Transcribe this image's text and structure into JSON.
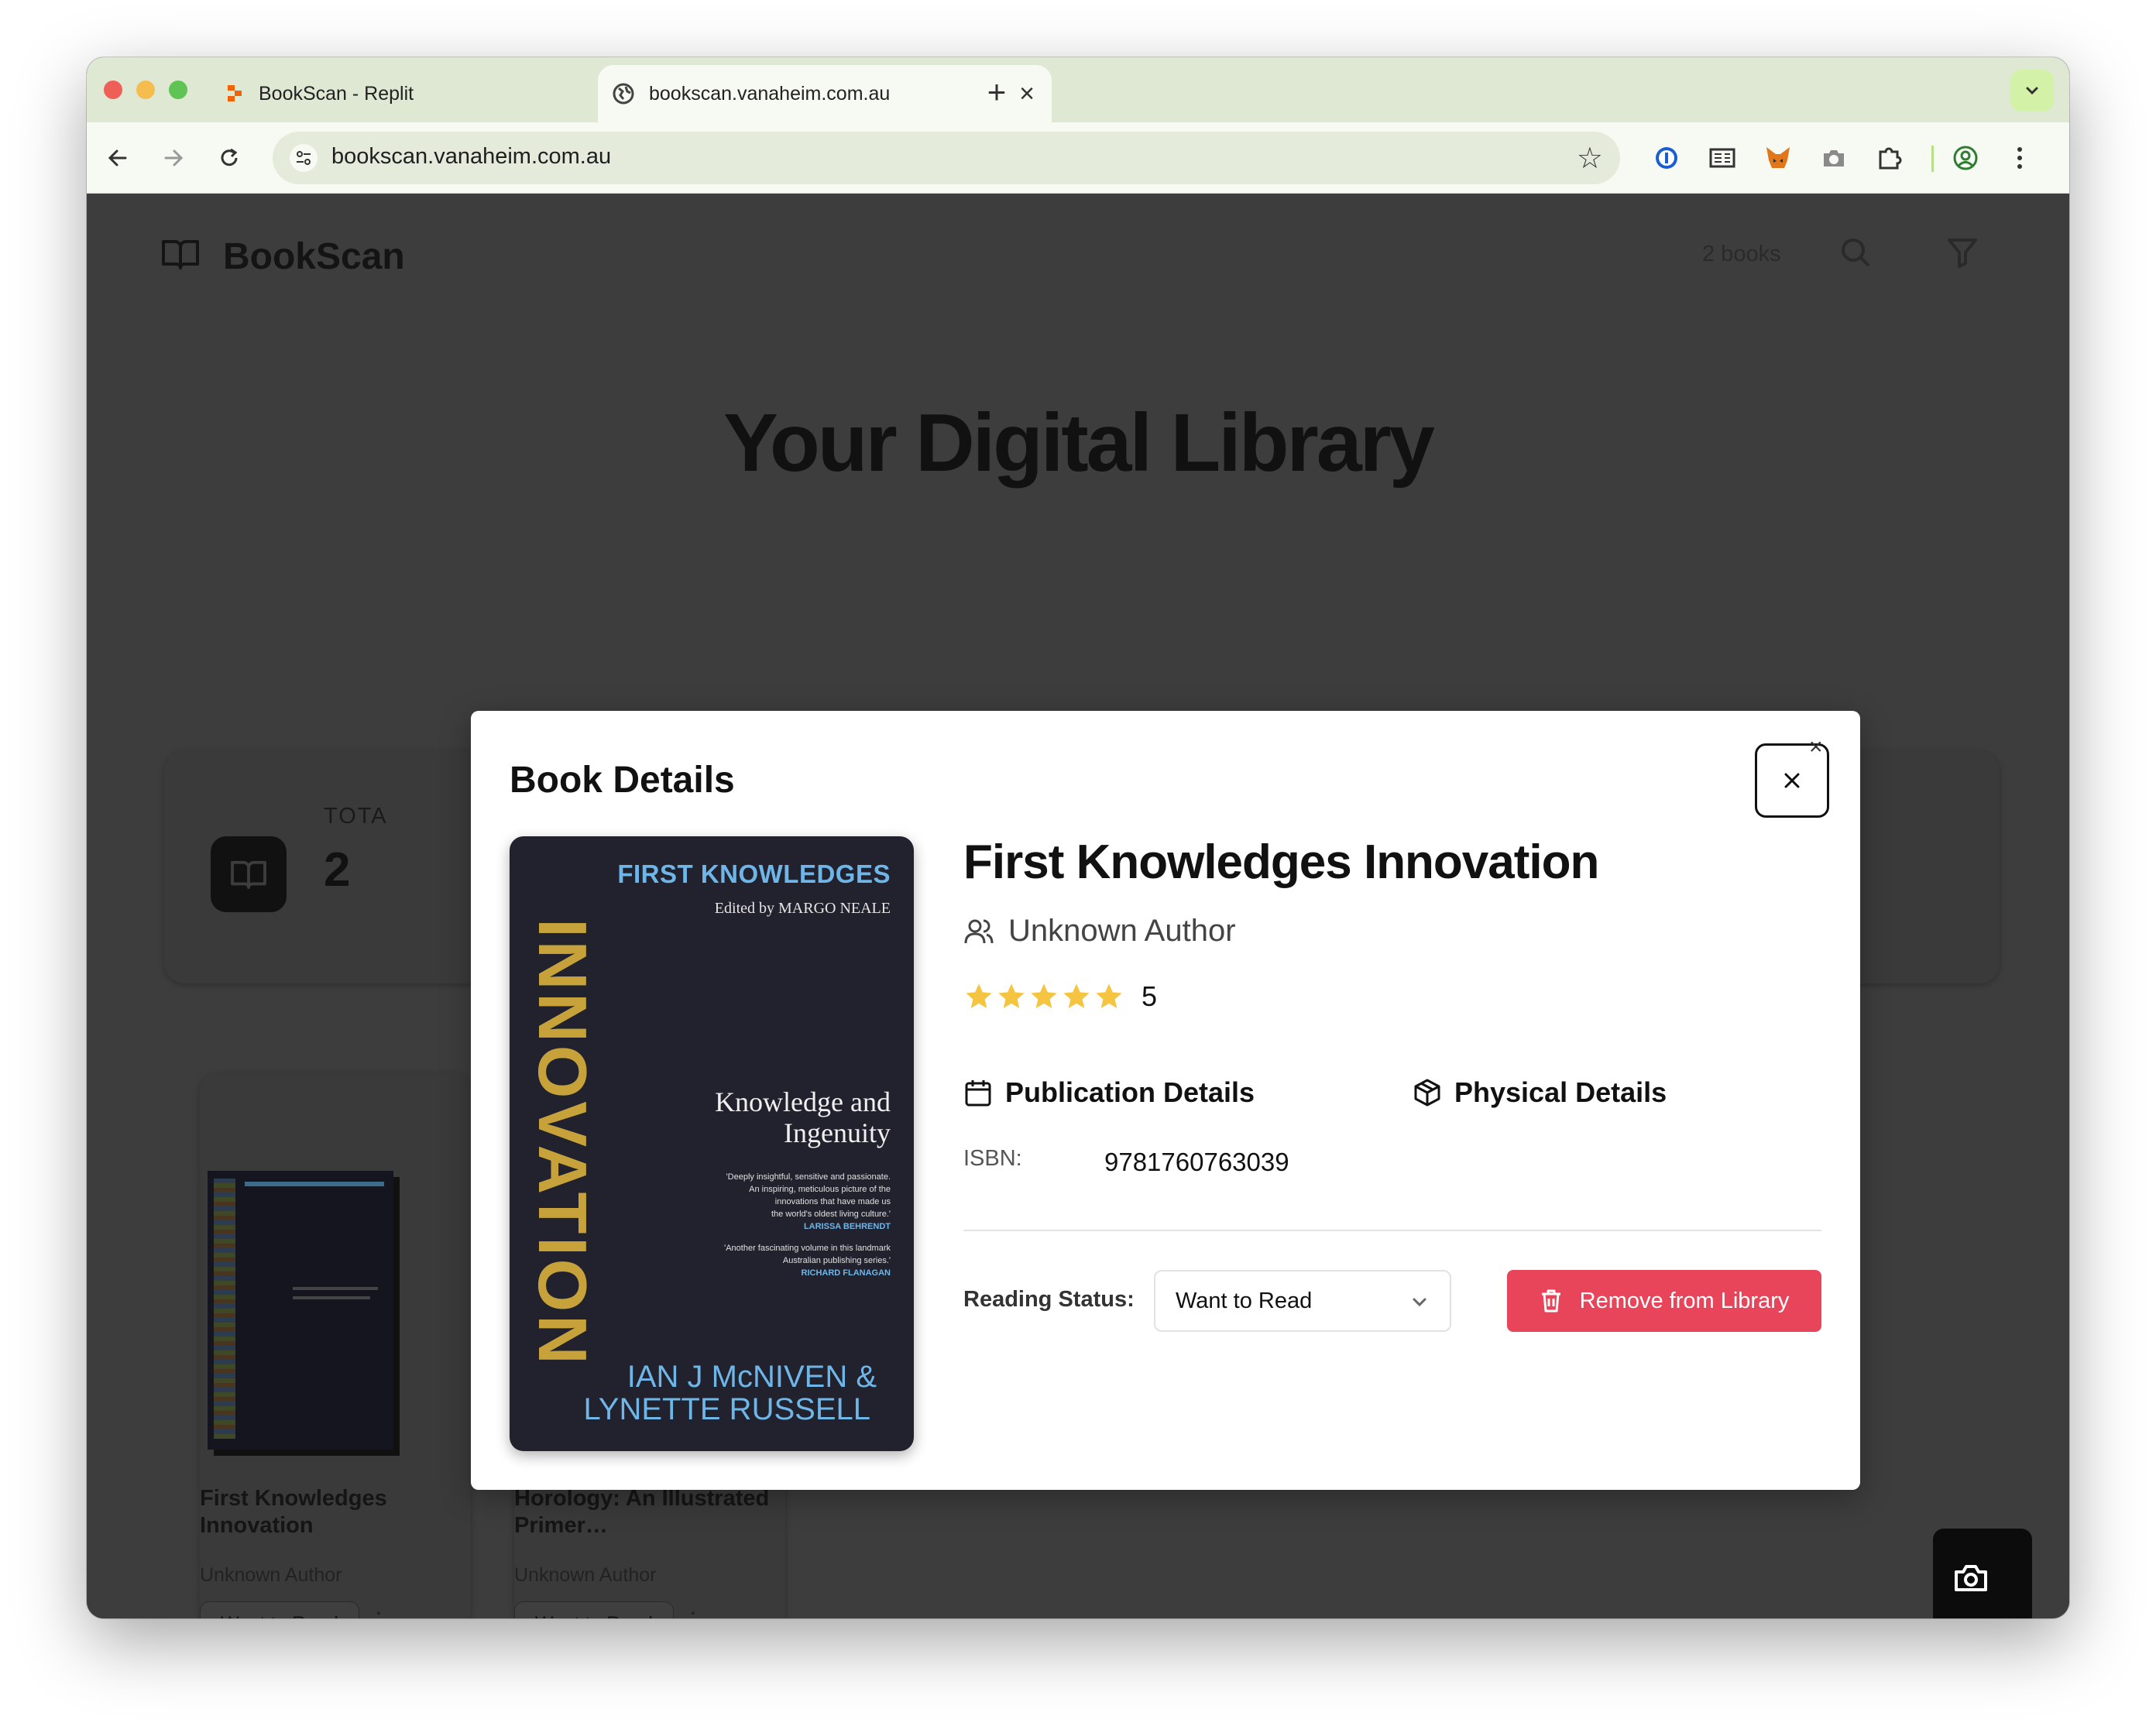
{
  "browser": {
    "tabs": [
      {
        "title": "BookScan - Replit",
        "active": false
      },
      {
        "title": "bookscan.vanaheim.com.au",
        "active": true
      }
    ],
    "new_tab_symbol": "+",
    "close_symbol": "×",
    "url": "bookscan.vanaheim.com.au",
    "extension_icons": [
      "password-manager-icon",
      "reader-icon",
      "fox-wallet-icon",
      "camera-icon",
      "puzzle-extensions-icon",
      "profile-icon",
      "kebab-menu-icon"
    ]
  },
  "app": {
    "brand": "BookScan",
    "books_count": "2 books",
    "hero_title": "Your Digital Library",
    "stats": {
      "label": "TOTA",
      "value": "2"
    },
    "cards": [
      {
        "title": "First Knowledges Innovation",
        "author": "Unknown Author",
        "status": "Want to Read",
        "more": "⋮"
      },
      {
        "title": "Horology: An Illustrated Primer…",
        "author": "Unknown Author",
        "status": "Want to Read",
        "more": "⋮"
      }
    ]
  },
  "modal": {
    "heading": "Book Details",
    "close_symbol": "×",
    "book": {
      "title": "First Knowledges Innovation",
      "author": "Unknown Author",
      "rating": 5,
      "rating_text": "5",
      "max_rating": 5
    },
    "publication_heading": "Publication Details",
    "physical_heading": "Physical Details",
    "isbn_label": "ISBN:",
    "isbn_value": "9781760763039",
    "reading_status_label": "Reading Status:",
    "reading_status_value": "Want to Read",
    "remove_button": "Remove from Library"
  },
  "cover": {
    "series": "FIRST KNOWLEDGES",
    "editor": "Edited by MARGO NEALE",
    "spine_word": "INNOVATION",
    "subtitle_line1": "Knowledge and",
    "subtitle_line2": "Ingenuity",
    "quote1_lines": [
      "'Deeply insightful, sensitive and passionate.",
      "An inspiring, meticulous picture of the",
      "innovations that have made us",
      "the world's oldest living culture.'"
    ],
    "quote1_source": "LARISSA BEHRENDT",
    "quote2_lines": [
      "'Another fascinating volume in this landmark",
      "Australian publishing series.'"
    ],
    "quote2_source": "RICHARD FLANAGAN",
    "authors_line1": "IAN J McNIVEN &",
    "authors_line2": "LYNETTE RUSSELL"
  },
  "colors": {
    "tabstrip": "#dfe8d3",
    "overlay": "#3d3d3d",
    "accent_danger": "#e8445a",
    "star": "#f5c542",
    "cover_bg": "#22222e",
    "cover_series": "#6fb6e8"
  }
}
